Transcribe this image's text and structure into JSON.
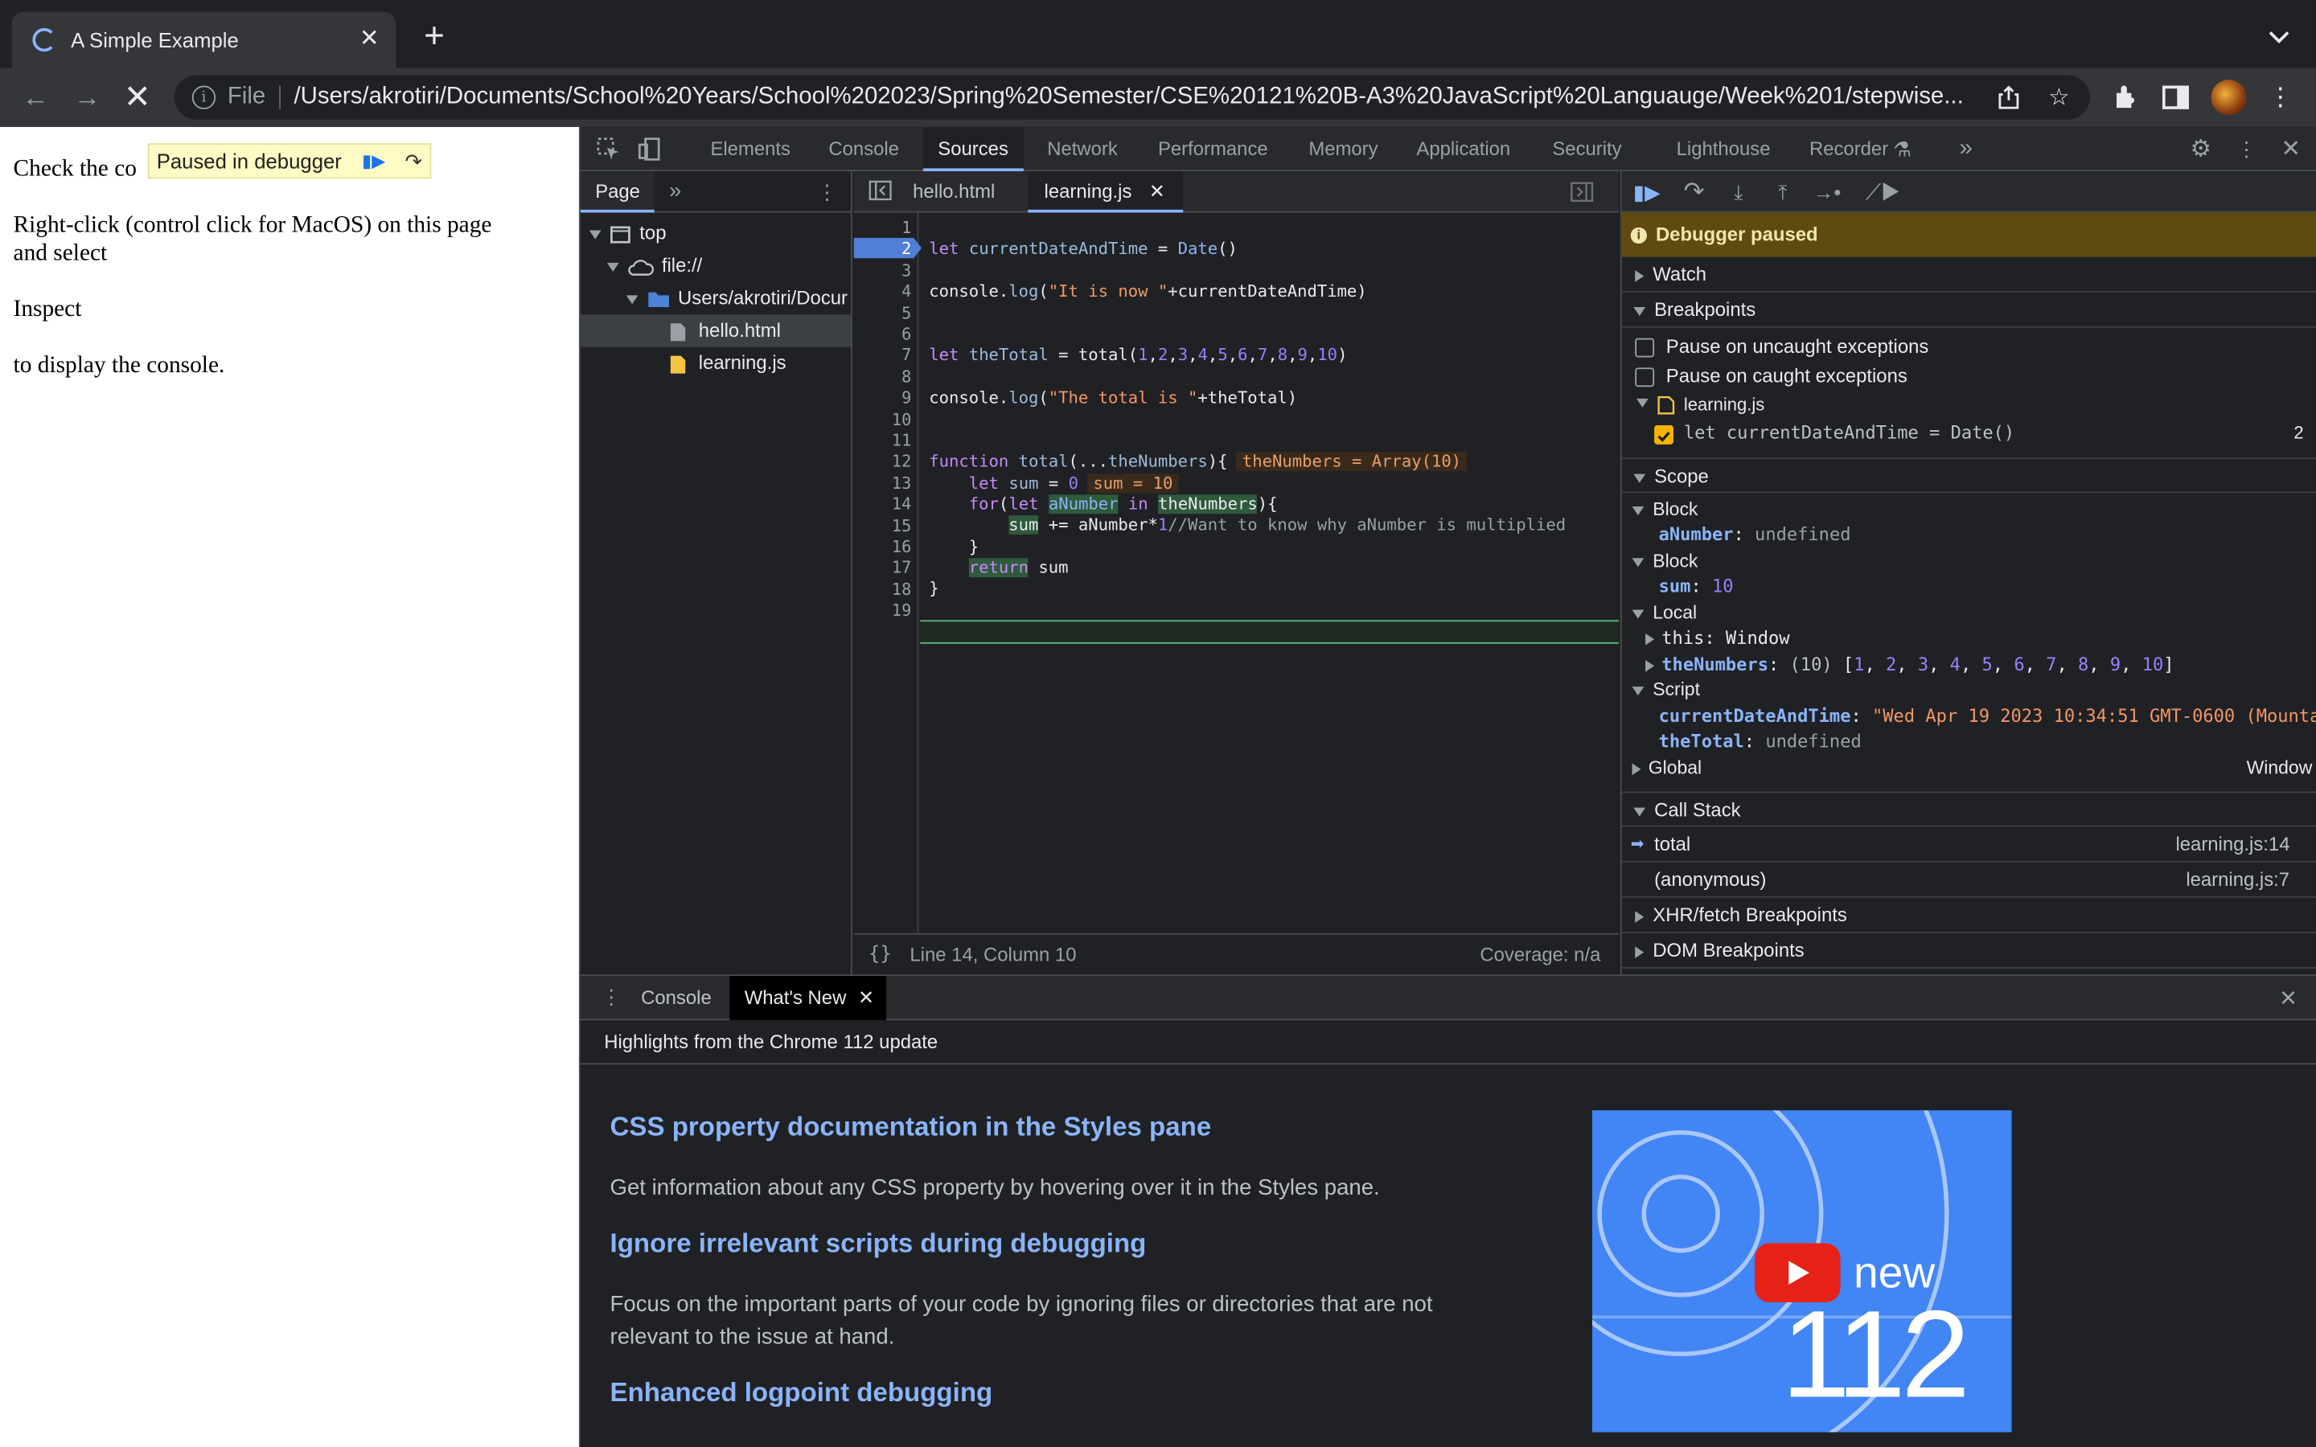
{
  "browser": {
    "tab_title": "A Simple Example",
    "new_tab": "+",
    "tab_close": "✕",
    "address_scheme": "File",
    "url": "/Users/akrotiri/Documents/School%20Years/School%202023/Spring%20Semester/CSE%20121%20B-A3%20JavaScript%20Languauge/Week%201/stepwise..."
  },
  "page": {
    "line1_start": "Check the co",
    "line2": "Right-click (control click for MacOS) on this page",
    "line2b": "and select",
    "line3": "Inspect",
    "line4": "to display the console.",
    "paused_banner": "Paused in debugger"
  },
  "devtools": {
    "tabs": [
      "Elements",
      "Console",
      "Sources",
      "Network",
      "Performance",
      "Memory",
      "Application",
      "Security",
      "Lighthouse",
      "Recorder"
    ],
    "active_tab": "Sources",
    "navigator": {
      "tab": "Page",
      "items": [
        {
          "label": "top"
        },
        {
          "label": "file://"
        },
        {
          "label": "Users/akrotiri/Docur"
        },
        {
          "label": "hello.html"
        },
        {
          "label": "learning.js"
        }
      ]
    },
    "editor": {
      "tabs": [
        "hello.html",
        "learning.js"
      ],
      "active_tab": "learning.js",
      "current_line": 14,
      "line_numbers": [
        "1",
        "2",
        "3",
        "4",
        "5",
        "6",
        "7",
        "8",
        "9",
        "10",
        "11",
        "12",
        "13",
        "14",
        "15",
        "16",
        "17",
        "18",
        "19"
      ],
      "status_position": "Line 14, Column 10",
      "status_coverage": "Coverage: n/a",
      "format_btn": "{}",
      "inline_numbers": "theNumbers = Array(10)",
      "inline_sum": "sum = 10",
      "comment": "//Want to know why aNumber is multiplied"
    },
    "debugger": {
      "paused": "Debugger paused",
      "watch": "Watch",
      "breakpoints": "Breakpoints",
      "pause_uncaught": "Pause on uncaught exceptions",
      "pause_caught": "Pause on caught exceptions",
      "bp_file": "learning.js",
      "bp_code": "let currentDateAndTime = Date()",
      "bp_line": "2",
      "scope": "Scope",
      "scope_items": {
        "block1": "Block",
        "anumber_key": "aNumber",
        "anumber_val": "undefined",
        "block2": "Block",
        "sum_key": "sum",
        "sum_val": "10",
        "local": "Local",
        "this_key": "this",
        "this_val": "Window",
        "thenumbers_key": "theNumbers",
        "thenumbers_len": "(10)",
        "script": "Script",
        "cdt_key": "currentDateAndTime",
        "cdt_val": "\"Wed Apr 19 2023 10:34:51 GMT-0600 (Mounta",
        "total_key": "theTotal",
        "total_val": "undefined",
        "global": "Global",
        "global_val": "Window"
      },
      "call_stack": "Call Stack",
      "frames": [
        {
          "name": "total",
          "loc": "learning.js:14"
        },
        {
          "name": "(anonymous)",
          "loc": "learning.js:7"
        }
      ],
      "xhr": "XHR/fetch Breakpoints",
      "dom": "DOM Breakpoints"
    },
    "drawer": {
      "tabs": [
        "Console",
        "What's New"
      ],
      "active_tab": "What's New",
      "highlights": "Highlights from the Chrome 112 update",
      "items": [
        {
          "title": "CSS property documentation in the Styles pane",
          "desc": "Get information about any CSS property by hovering over it in the Styles pane."
        },
        {
          "title": "Ignore irrelevant scripts during debugging",
          "desc": "Focus on the important parts of your code by ignoring files or directories that are not relevant to the issue at hand."
        },
        {
          "title": "Enhanced logpoint debugging",
          "desc": ""
        }
      ],
      "video_new": "new",
      "video_version": "112"
    }
  }
}
